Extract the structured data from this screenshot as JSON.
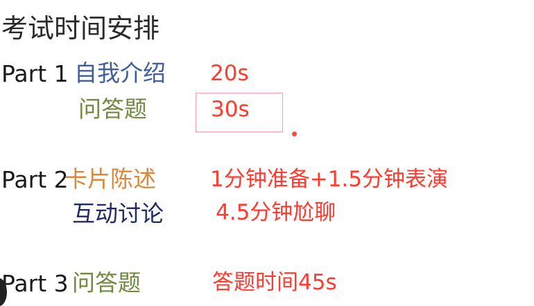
{
  "title": "考试时间安排",
  "colors": {
    "part_label": "#1a1a1a",
    "time": "#ff3b30",
    "topic_blue": "#3f5f9c",
    "topic_green": "#6e8a3e",
    "topic_orange": "#d88a3a",
    "topic_navy": "#1f2a66",
    "highlight_border": "#f0a0b0"
  },
  "sections": {
    "part1": {
      "label": "Part 1",
      "items": [
        {
          "topic": "自我介绍",
          "time": "20s"
        },
        {
          "topic": "问答题",
          "time": "30s"
        }
      ]
    },
    "part2": {
      "label": "Part 2",
      "items": [
        {
          "topic": "卡片陈述",
          "time": "1分钟准备+1.5分钟表演"
        },
        {
          "topic": "互动讨论",
          "time": "4.5分钟尬聊"
        }
      ]
    },
    "part3": {
      "label": "Part 3",
      "items": [
        {
          "topic": "问答题",
          "time": "答题时间45s"
        }
      ]
    }
  }
}
